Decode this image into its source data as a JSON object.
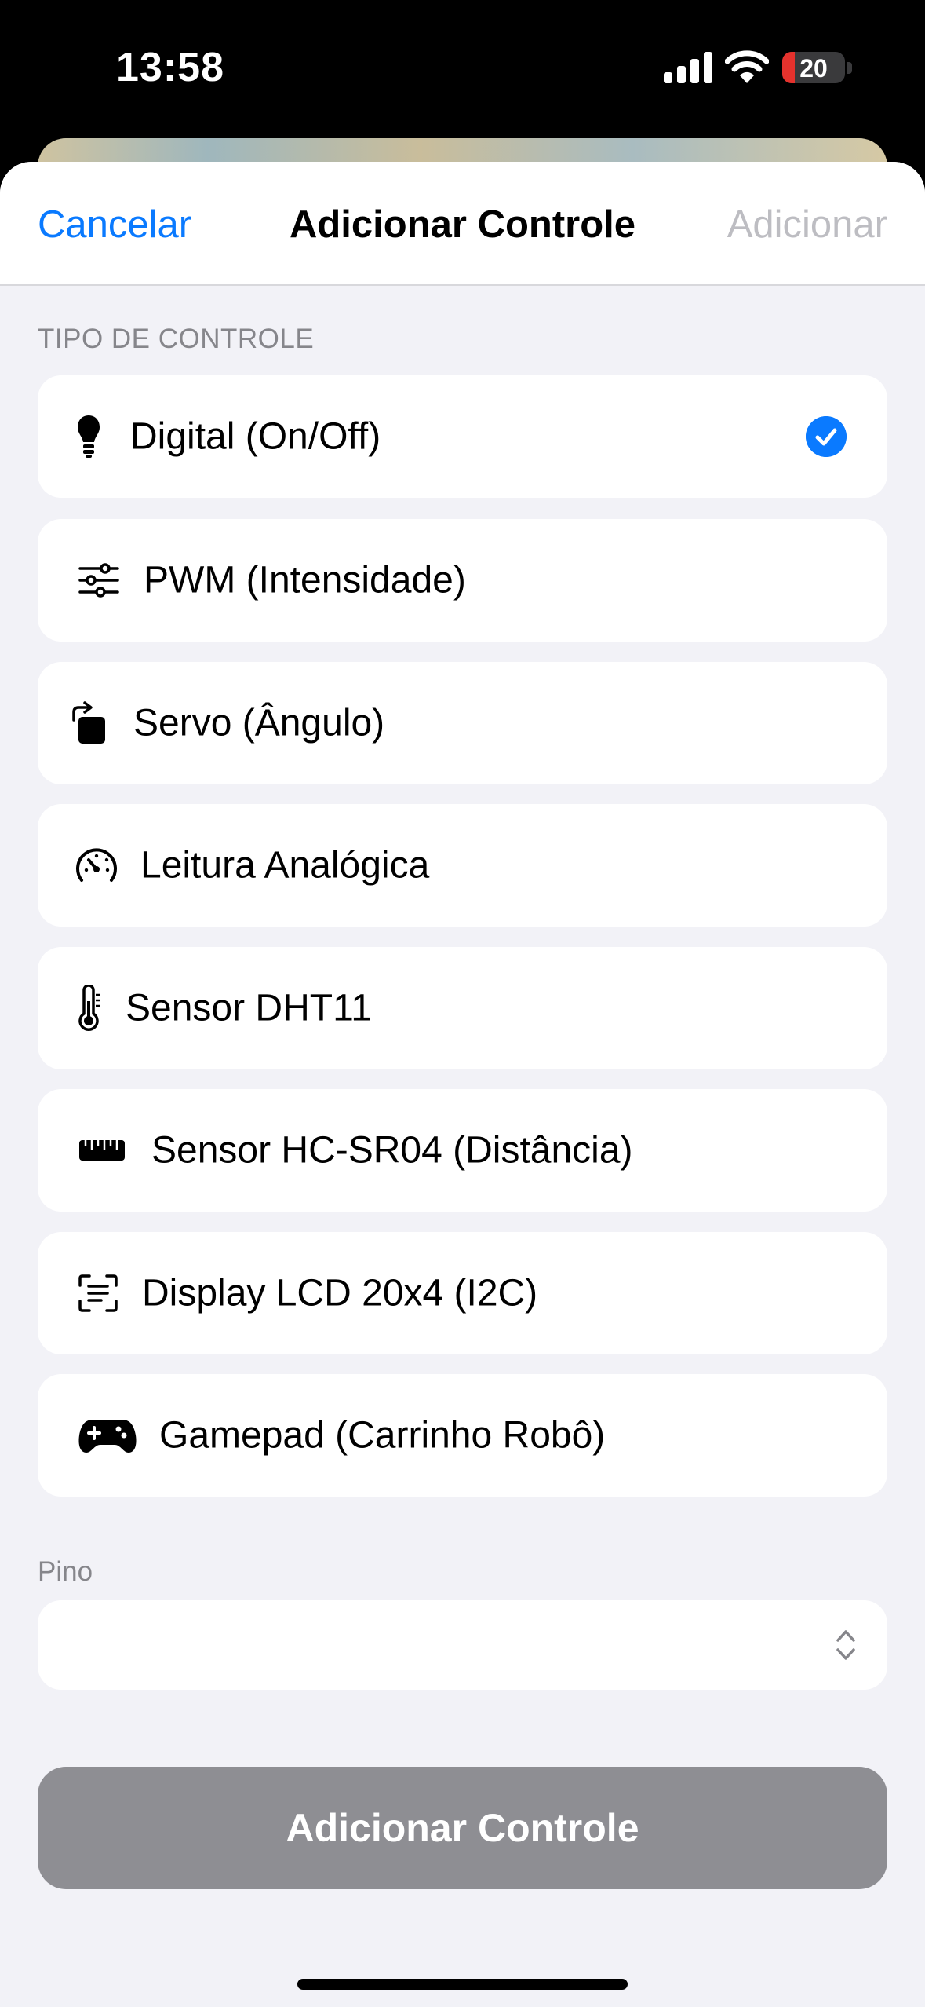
{
  "status_bar": {
    "time": "13:58",
    "battery": "20",
    "battery_level": 0.2,
    "battery_color": "#e5322d"
  },
  "nav": {
    "cancel_label": "Cancelar",
    "title": "Adicionar Controle",
    "add_label": "Adicionar"
  },
  "section": {
    "header": "TIPO DE CONTROLE"
  },
  "control_types": [
    {
      "label": "Digital (On/Off)",
      "icon": "lightbulb-icon",
      "selected": true
    },
    {
      "label": "PWM (Intensidade)",
      "icon": "sliders-icon",
      "selected": false
    },
    {
      "label": "Servo (Ângulo)",
      "icon": "rotate-icon",
      "selected": false
    },
    {
      "label": "Leitura Analógica",
      "icon": "gauge-icon",
      "selected": false
    },
    {
      "label": "Sensor DHT11",
      "icon": "thermometer-icon",
      "selected": false
    },
    {
      "label": "Sensor HC-SR04 (Distância)",
      "icon": "ruler-icon",
      "selected": false
    },
    {
      "label": "Display LCD 20x4 (I2C)",
      "icon": "text-viewfinder-icon",
      "selected": false
    },
    {
      "label": "Gamepad (Carrinho Robô)",
      "icon": "gamecontroller-icon",
      "selected": false
    }
  ],
  "pin": {
    "label": "Pino",
    "value": ""
  },
  "primary_button": {
    "label": "Adicionar Controle"
  },
  "colors": {
    "accent": "#0a7aff",
    "disabled_text": "#bdbdc2",
    "disabled_button": "#8e8e93",
    "background": "#f2f2f7"
  }
}
